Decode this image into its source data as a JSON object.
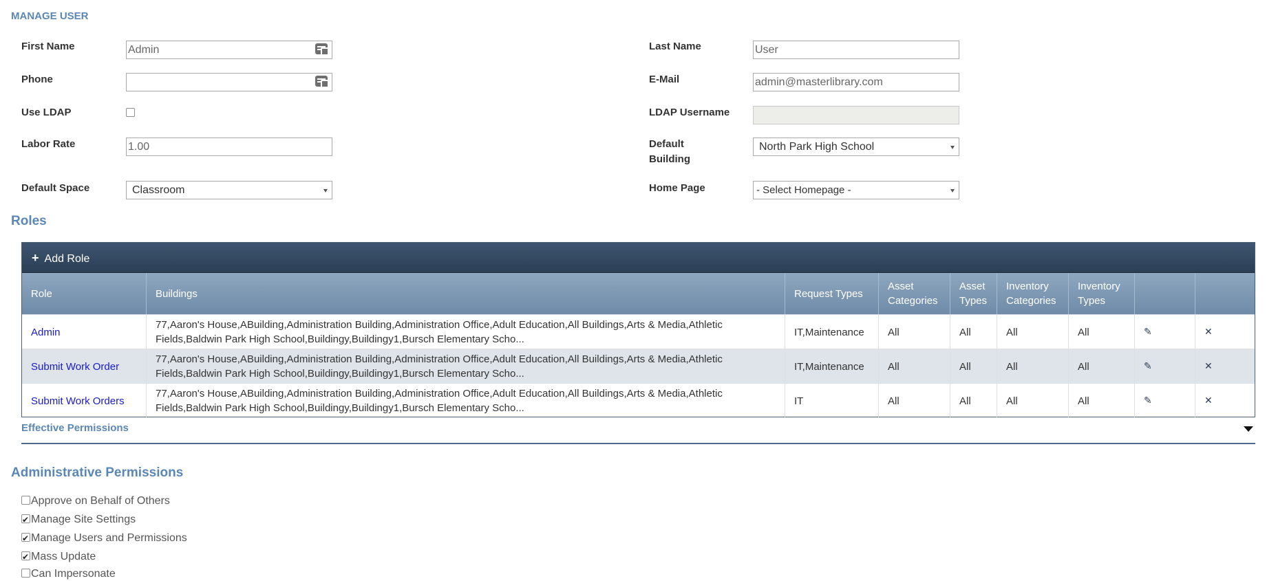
{
  "page": {
    "title": "MANAGE USER"
  },
  "form": {
    "first_name": {
      "label": "First Name",
      "value": "Admin"
    },
    "last_name": {
      "label": "Last Name",
      "value": "User"
    },
    "phone": {
      "label": "Phone",
      "value": ""
    },
    "email": {
      "label": "E-Mail",
      "value": "admin@masterlibrary.com"
    },
    "use_ldap": {
      "label": "Use LDAP",
      "checked": false
    },
    "ldap_username": {
      "label": "LDAP Username",
      "value": ""
    },
    "labor_rate": {
      "label": "Labor Rate",
      "value": "1.00"
    },
    "default_building": {
      "label_line1": "Default",
      "label_line2": "Building",
      "value": "North Park High School"
    },
    "default_space": {
      "label": "Default Space",
      "value": "Classroom"
    },
    "home_page": {
      "label": "Home Page",
      "value": "- Select Homepage -"
    }
  },
  "roles": {
    "title": "Roles",
    "add_label": "Add Role",
    "columns": {
      "role": "Role",
      "buildings": "Buildings",
      "request_types": "Request Types",
      "asset_categories_1": "Asset",
      "asset_categories_2": "Categories",
      "asset_types_1": "Asset",
      "asset_types_2": "Types",
      "inventory_categories_1": "Inventory",
      "inventory_categories_2": "Categories",
      "inventory_types_1": "Inventory",
      "inventory_types_2": "Types"
    },
    "rows": [
      {
        "role": "Admin",
        "buildings_line1": "77,Aaron's House,ABuilding,Administration Building,Administration Office,Adult Education,All Buildings,Arts & Media,Athletic",
        "buildings_line2": "Fields,Baldwin Park High School,Buildingy,Buildingy1,Bursch Elementary Scho...",
        "request_types": "IT,Maintenance",
        "asset_categories": "All",
        "asset_types": "All",
        "inventory_categories": "All",
        "inventory_types": "All"
      },
      {
        "role": "Submit Work Order",
        "buildings_line1": "77,Aaron's House,ABuilding,Administration Building,Administration Office,Adult Education,All Buildings,Arts & Media,Athletic",
        "buildings_line2": "Fields,Baldwin Park High School,Buildingy,Buildingy1,Bursch Elementary Scho...",
        "request_types": "IT,Maintenance",
        "asset_categories": "All",
        "asset_types": "All",
        "inventory_categories": "All",
        "inventory_types": "All"
      },
      {
        "role": "Submit Work Orders",
        "buildings_line1": "77,Aaron's House,ABuilding,Administration Building,Administration Office,Adult Education,All Buildings,Arts & Media,Athletic",
        "buildings_line2": "Fields,Baldwin Park High School,Buildingy,Buildingy1,Bursch Elementary Scho...",
        "request_types": "IT",
        "asset_categories": "All",
        "asset_types": "All",
        "inventory_categories": "All",
        "inventory_types": "All"
      }
    ]
  },
  "effective_permissions": {
    "label": "Effective Permissions"
  },
  "admin_permissions": {
    "title": "Administrative Permissions",
    "items": [
      {
        "label": "Approve on Behalf of Others",
        "checked": false
      },
      {
        "label": "Manage Site Settings",
        "checked": true
      },
      {
        "label": "Manage Users and Permissions",
        "checked": true
      },
      {
        "label": "Mass Update",
        "checked": true
      },
      {
        "label": "Can Impersonate",
        "checked": false
      }
    ]
  },
  "icons": {
    "input_helper": "contact-card-icon",
    "edit": "pencil-icon",
    "delete": "delete-x-icon",
    "expand": "caret-down-icon",
    "add": "plus-icon"
  },
  "colors": {
    "heading": "#5b87b5",
    "toolbar": "#2f455e",
    "header": "#7f99b5",
    "link": "#1a1acc",
    "alt_row": "#dee4ea"
  }
}
